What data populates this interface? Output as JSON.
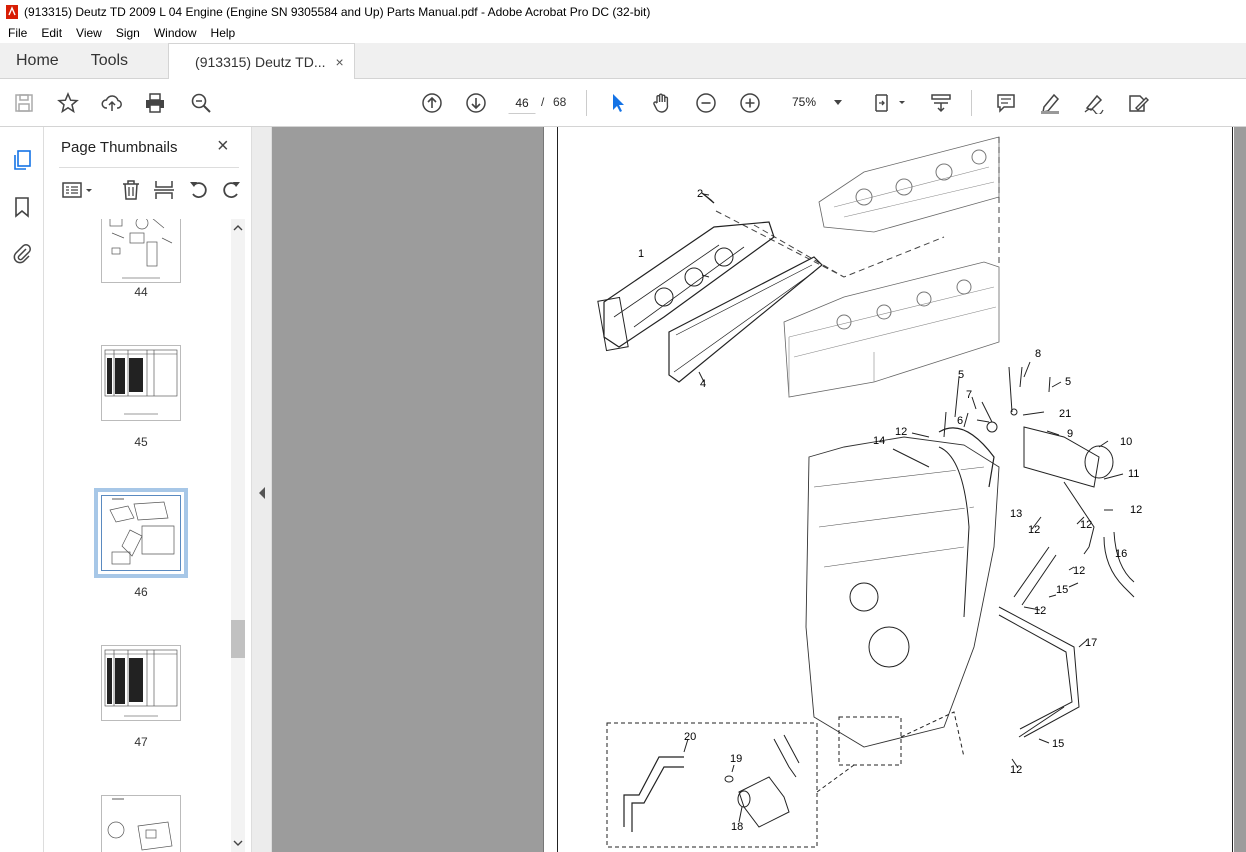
{
  "window": {
    "title": "(913315) Deutz TD 2009 L 04 Engine (Engine SN 9305584 and Up) Parts Manual.pdf - Adobe Acrobat Pro DC (32-bit)"
  },
  "menu": [
    "File",
    "Edit",
    "View",
    "Sign",
    "Window",
    "Help"
  ],
  "tabs": {
    "home": "Home",
    "tools": "Tools",
    "doc": "(913315) Deutz TD...",
    "close": "×"
  },
  "toolbar": {
    "page_current": "46",
    "page_sep": "/",
    "page_total": "68",
    "zoom": "75%"
  },
  "panel": {
    "title": "Page Thumbnails",
    "close": "×"
  },
  "thumbnails": [
    {
      "num": "44"
    },
    {
      "num": "45"
    },
    {
      "num": "46",
      "selected": true
    },
    {
      "num": "47"
    }
  ],
  "diagram": {
    "labels": [
      "1",
      "2",
      "4",
      "5",
      "5",
      "6",
      "7",
      "8",
      "9",
      "10",
      "11",
      "12",
      "12",
      "12",
      "12",
      "12",
      "12",
      "12",
      "13",
      "14",
      "15",
      "15",
      "16",
      "17",
      "18",
      "19",
      "20",
      "21"
    ]
  },
  "colors": {
    "accent": "#1473e6",
    "viewer_bg": "#9c9c9c",
    "selected_outline": "#a7c7e7"
  }
}
